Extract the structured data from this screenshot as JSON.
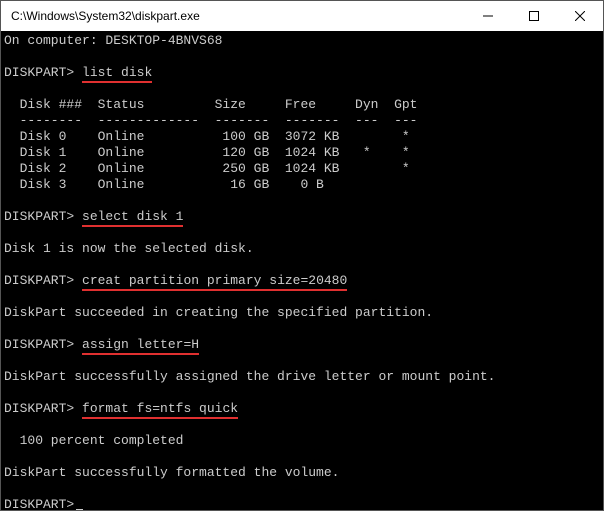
{
  "window": {
    "title": "C:\\Windows\\System32\\diskpart.exe"
  },
  "terminal": {
    "line_computer": "On computer: DESKTOP-4BNVS68",
    "prompt": "DISKPART>",
    "cmd_list_disk": "list disk",
    "table": {
      "header": "  Disk ###  Status         Size     Free     Dyn  Gpt",
      "divider": "  --------  -------------  -------  -------  ---  ---",
      "rows": [
        "  Disk 0    Online          100 GB  3072 KB        *",
        "  Disk 1    Online          120 GB  1024 KB   *    *",
        "  Disk 2    Online          250 GB  1024 KB        *",
        "  Disk 3    Online           16 GB    0 B"
      ]
    },
    "cmd_select": "select disk 1",
    "msg_select": "Disk 1 is now the selected disk.",
    "cmd_create": "creat partition primary size=20480",
    "msg_create": "DiskPart succeeded in creating the specified partition.",
    "cmd_assign": "assign letter=H",
    "msg_assign": "DiskPart successfully assigned the drive letter or mount point.",
    "cmd_format": "format fs=ntfs quick",
    "msg_progress": "  100 percent completed",
    "msg_format": "DiskPart successfully formatted the volume."
  }
}
